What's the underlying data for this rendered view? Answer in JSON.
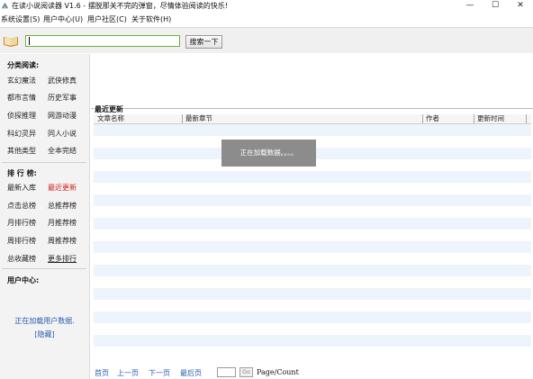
{
  "window": {
    "title": "在读小说阅读器 V1.6 - 摆脱那关不完的弹窗，尽情体验阅读的快乐!",
    "min_glyph": "—",
    "max_glyph": "☐",
    "close_glyph": "✕"
  },
  "menu": {
    "items": [
      "系统设置(S)",
      "用户中心(U)",
      "用户社区(C)",
      "关于软件(H)"
    ]
  },
  "toolbar": {
    "search_value": "",
    "search_button": "搜索一下"
  },
  "sidebar": {
    "categories_title": "分类阅读:",
    "categories": [
      [
        "玄幻魔法",
        "武侠修真"
      ],
      [
        "都市言情",
        "历史军事"
      ],
      [
        "侦探推理",
        "网游动漫"
      ],
      [
        "科幻灵异",
        "同人小说"
      ],
      [
        "其他类型",
        "全本完结"
      ]
    ],
    "rankings_title": "排 行 榜:",
    "rankings": [
      [
        "最新入库",
        "最近更新"
      ],
      [
        "点击总榜",
        "总推荐榜"
      ],
      [
        "月排行榜",
        "月推荐榜"
      ],
      [
        "周排行榜",
        "周推荐榜"
      ],
      [
        "总收藏榜",
        "更多排行"
      ]
    ],
    "user_title": "用户中心:",
    "user_loading": "正在加载用户数据.",
    "user_hide": "[隐藏]"
  },
  "recent": {
    "legend": "最近更新",
    "columns": [
      "文章名称",
      "最新章节",
      "作者",
      "更新时间"
    ],
    "loading": "正在加载数据。。。。"
  },
  "pager": {
    "first": "首页",
    "prev": "上一页",
    "next": "下一页",
    "last": "最后页",
    "page_value": "",
    "go": "Go",
    "count": "Page/Count"
  },
  "colors": {
    "accent_green": "#6fae42",
    "link_blue": "#2a5db0",
    "highlight_red": "#d21b1b",
    "row_alt": "#eef4fb"
  }
}
